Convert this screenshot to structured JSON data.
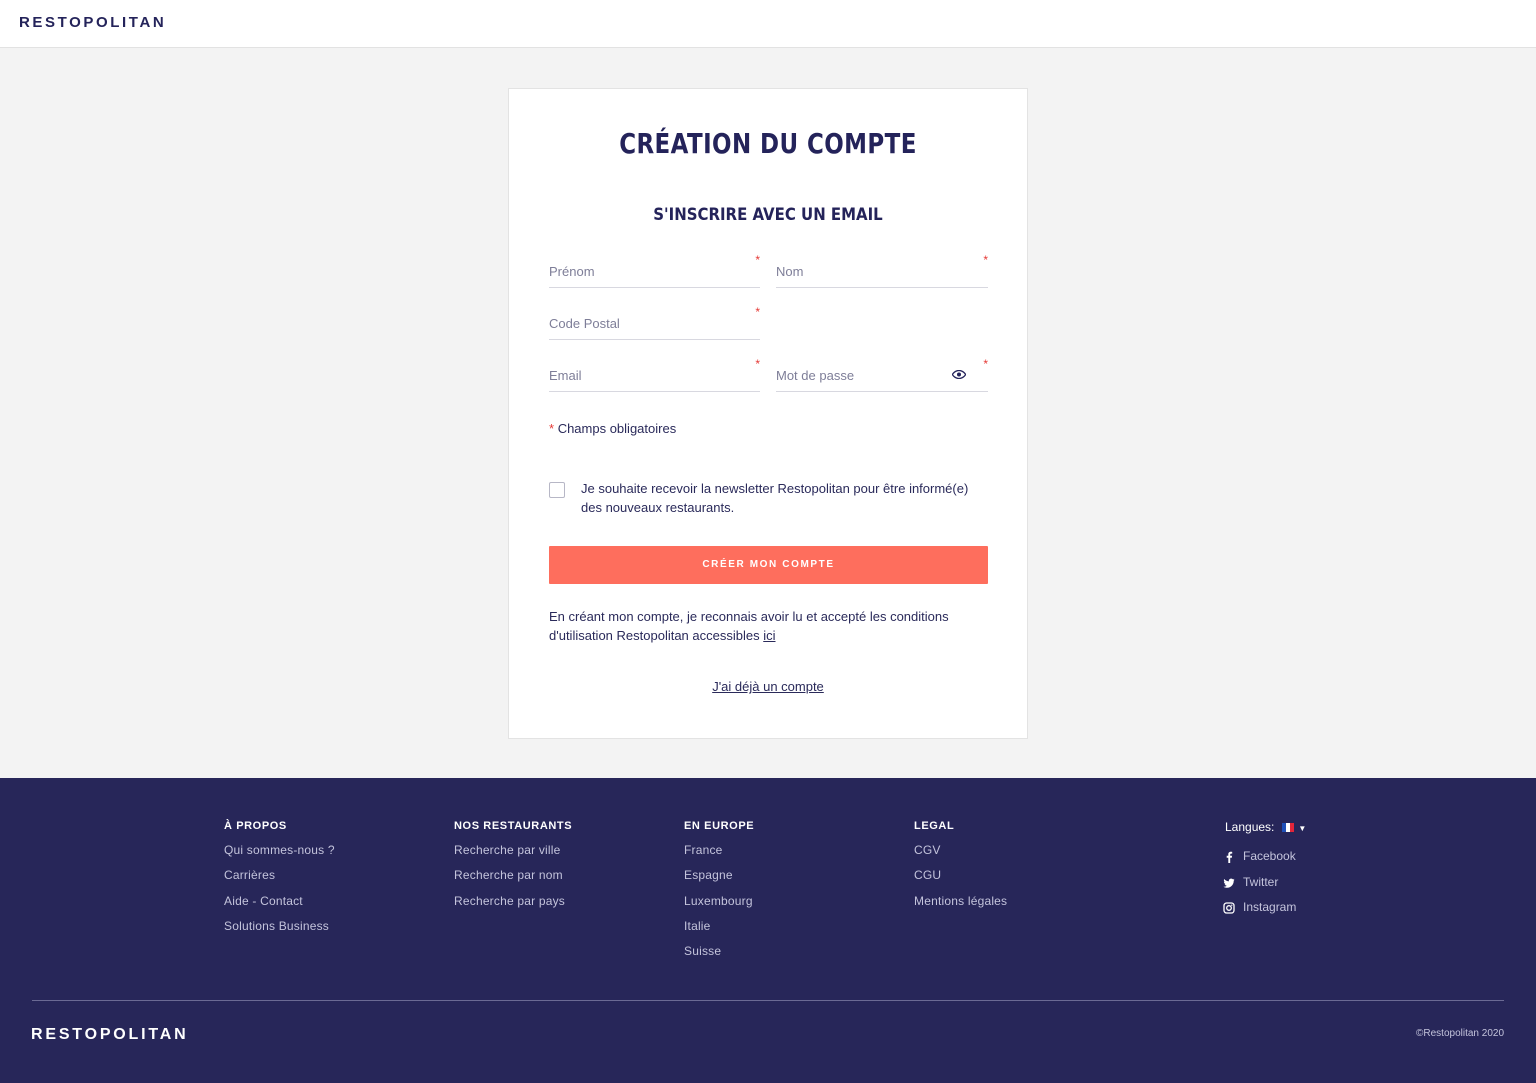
{
  "header": {
    "logo": "RESTOPOLITAN"
  },
  "form": {
    "title": "CRÉATION DU COMPTE",
    "subtitle": "S'INSCRIRE AVEC UN EMAIL",
    "required_mark": "*",
    "fields": {
      "firstname": {
        "placeholder": "Prénom",
        "value": ""
      },
      "lastname": {
        "placeholder": "Nom",
        "value": ""
      },
      "postal": {
        "placeholder": "Code Postal",
        "value": ""
      },
      "email": {
        "placeholder": "Email",
        "value": ""
      },
      "password": {
        "placeholder": "Mot de passe",
        "value": ""
      }
    },
    "required_note": "Champs obligatoires",
    "newsletter_label": "Je souhaite recevoir la newsletter Restopolitan pour être informé(e) des nouveaux restaurants.",
    "newsletter_checked": false,
    "submit_label": "CRÉER MON COMPTE",
    "terms_text": "En créant mon compte, je reconnais avoir lu et accepté les conditions d'utilisation Restopolitan accessibles",
    "terms_link": "ici",
    "login_link": "J'ai déjà un compte"
  },
  "footer": {
    "columns": [
      {
        "title": "À PROPOS",
        "links": [
          "Qui sommes-nous ?",
          "Carrières",
          "Aide - Contact",
          "Solutions Business"
        ]
      },
      {
        "title": "NOS RESTAURANTS",
        "links": [
          "Recherche par ville",
          "Recherche par nom",
          "Recherche par pays"
        ]
      },
      {
        "title": "EN EUROPE",
        "links": [
          "France",
          "Espagne",
          "Luxembourg",
          "Italie",
          "Suisse"
        ]
      },
      {
        "title": "LEGAL",
        "links": [
          "CGV",
          "CGU",
          "Mentions légales"
        ]
      }
    ],
    "language_label": "Langues:",
    "language_flag_icon": "france-flag-icon",
    "social": [
      {
        "icon": "facebook-icon",
        "label": "Facebook"
      },
      {
        "icon": "twitter-icon",
        "label": "Twitter"
      },
      {
        "icon": "instagram-icon",
        "label": "Instagram"
      }
    ],
    "logo": "RESTOPOLITAN",
    "copyright": "©Restopolitan 2020"
  },
  "colors": {
    "brand_navy": "#24235a",
    "footer_bg": "#272659",
    "cta": "#fe6e5d",
    "required": "#e53935",
    "page_bg": "#f3f3f3"
  }
}
